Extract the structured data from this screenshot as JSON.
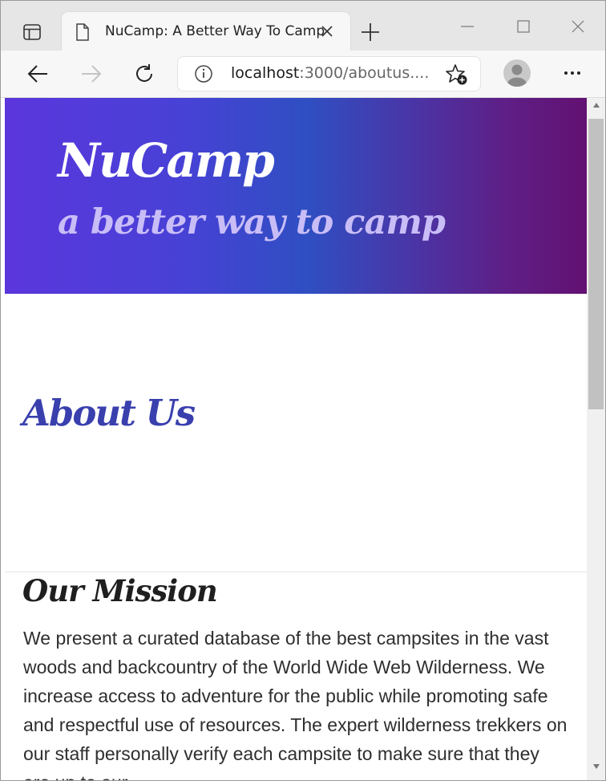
{
  "browser": {
    "tab": {
      "title": "NuCamp: A Better Way To Camp",
      "icon": "document-icon"
    },
    "address_bar": {
      "host": "localhost",
      "rest": ":3000/aboutus...."
    },
    "colors": {
      "tabstrip": "#e6e6e6",
      "toolbar": "#f7f7f7"
    }
  },
  "page": {
    "brand": "NuCamp",
    "tagline": "a better way to camp",
    "heading": "About Us",
    "mission": {
      "title": "Our Mission",
      "text": "We present a curated database of the best campsites in the vast woods and backcountry of the World Wide Web Wilderness. We increase access to adventure for the public while promoting safe and respectful use of resources. The expert wilderness trekkers on our staff personally verify each campsite to make sure that they are up to our"
    },
    "colors": {
      "gradient_start": "#5b36dc",
      "gradient_mid": "#2f4fc2",
      "gradient_end": "#631172",
      "tagline": "#c9bdf7",
      "heading": "#3a3fae"
    }
  }
}
